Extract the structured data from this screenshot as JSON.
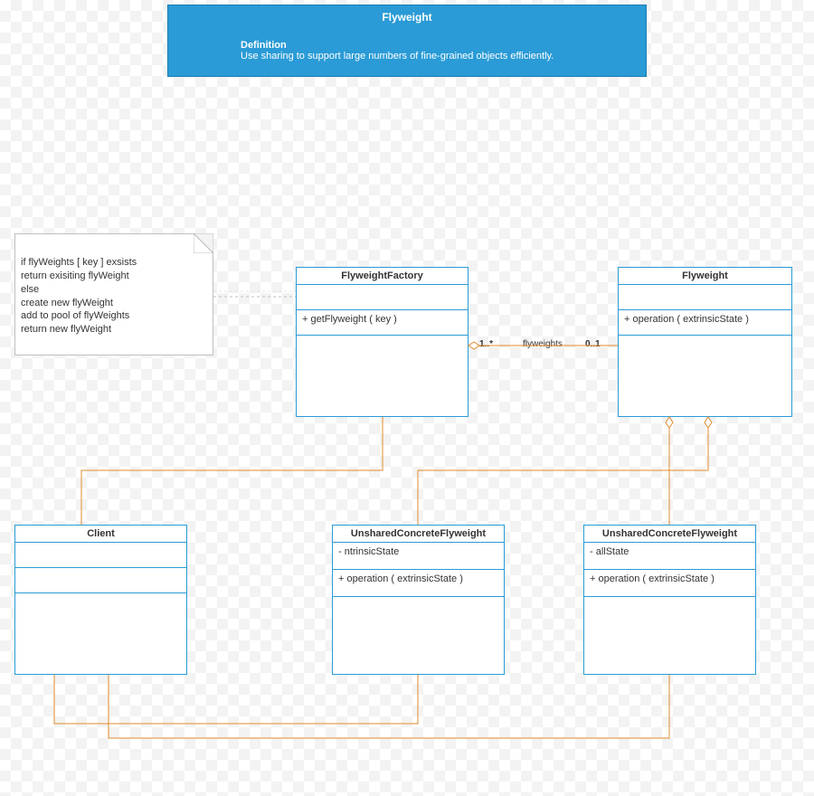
{
  "header": {
    "title": "Flyweight",
    "def_label": "Definition",
    "def_text": "Use sharing to support large numbers of fine-grained objects efficiently."
  },
  "note": {
    "l1": "if flyWeights [ key ] exsists",
    "l2": "return exisiting flyWeight",
    "l3": "else",
    "l4": "create new flyWeight",
    "l5": "add to pool of flyWeights",
    "l6": "return new flyWeight"
  },
  "factory": {
    "name": "FlyweightFactory",
    "op1": "+ getFlyweight ( key )"
  },
  "flyweight": {
    "name": "Flyweight",
    "op1": "+ operation ( extrinsicState )"
  },
  "client": {
    "name": "Client"
  },
  "unshared1": {
    "name": "UnsharedConcreteFlyweight",
    "attr1": "- ntrinsicState",
    "op1": "+ operation ( extrinsicState )"
  },
  "unshared2": {
    "name": "UnsharedConcreteFlyweight",
    "attr1": "- allState",
    "op1": "+ operation ( extrinsicState )"
  },
  "assoc": {
    "leftMult": "1..*",
    "name": "flyweights",
    "rightMult": "0..1"
  }
}
